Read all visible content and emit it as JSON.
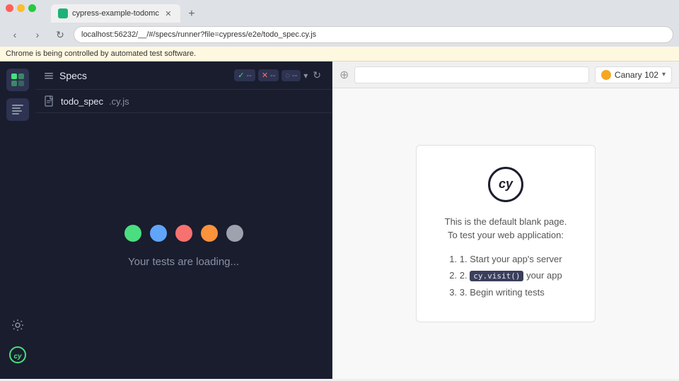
{
  "browser": {
    "tab_title": "cypress-example-todomc",
    "url": "localhost:56232/__/#/specs/runner?file=cypress/e2e/todo_spec.cy.js",
    "info_bar": "Chrome is being controlled by automated test software.",
    "new_tab_tooltip": "+"
  },
  "toolbar": {
    "specs_label": "Specs",
    "pass_count": "--",
    "fail_count": "--",
    "skip_count": "--",
    "spinner": "--"
  },
  "spec": {
    "filename": "todo_spec",
    "extension": ".cy.js"
  },
  "loading": {
    "text": "Your tests are loading...",
    "dots": [
      "green",
      "blue",
      "red",
      "orange",
      "gray"
    ]
  },
  "preview": {
    "browser_name": "Canary 102",
    "blank_page_title": "",
    "blank_page_desc_line1": "This is the default blank page.",
    "blank_page_desc_line2": "To test your web application:",
    "step1": "Start your app's server",
    "step2_before": "",
    "step2_code": "cy.visit()",
    "step2_after": " your app",
    "step3": "Begin writing tests"
  },
  "icons": {
    "back": "‹",
    "forward": "›",
    "refresh": "↻",
    "globe": "⊕",
    "checkmark": "✓",
    "cross": "✕",
    "dash": "—",
    "dropdown": "▾",
    "doc_icon": "📄",
    "menu_icon": "☰",
    "grid_icon": "⊞",
    "settings_icon": "⚙",
    "keyboard_icon": "⌘",
    "cy_text": "cy"
  }
}
